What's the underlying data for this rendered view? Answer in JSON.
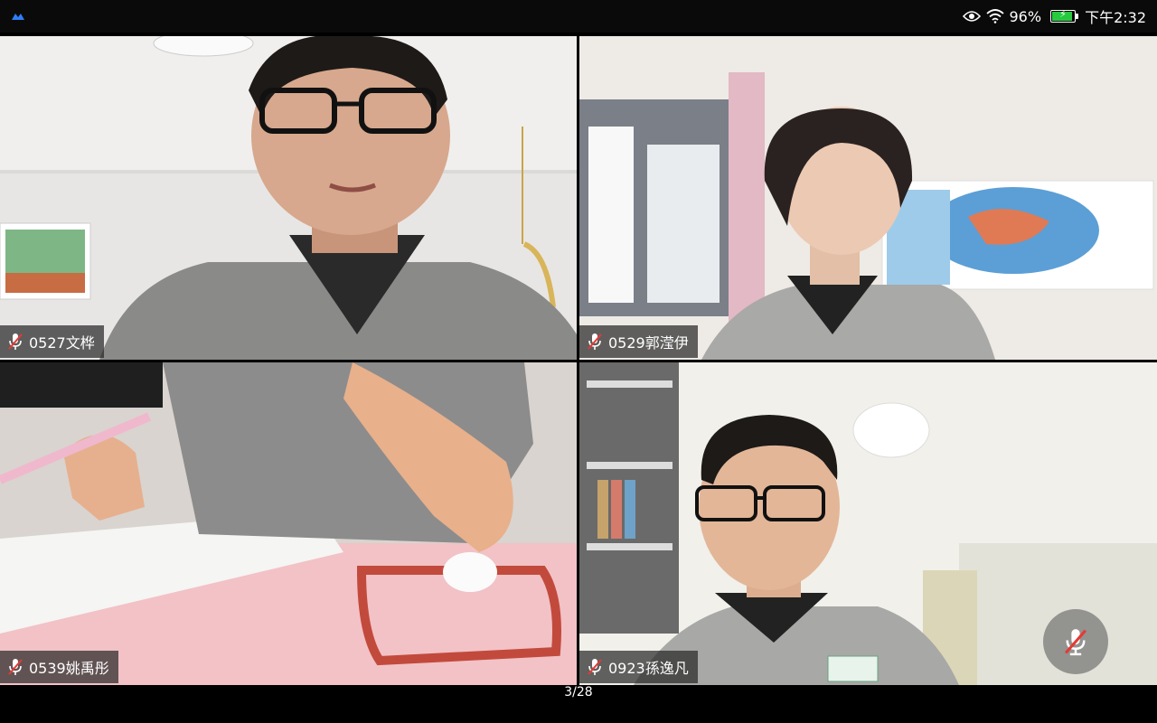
{
  "status_bar": {
    "app_icon": "meeting-app-icon",
    "eye_icon": "eye-comfort-icon",
    "wifi_icon": "wifi-icon",
    "battery_percent": "96%",
    "battery_level": 0.96,
    "battery_color": "#27c93f",
    "time": "下午2:32"
  },
  "participants": [
    {
      "name": "0527文桦",
      "mic_state": "muted",
      "mic_icon": "mic-muted-icon"
    },
    {
      "name": "0529郭滢伊",
      "mic_state": "muted",
      "mic_icon": "mic-muted-icon"
    },
    {
      "name": "0539姚禹彤",
      "mic_state": "muted",
      "mic_icon": "mic-muted-icon"
    },
    {
      "name": "0923孫逸凡",
      "mic_state": "muted",
      "mic_icon": "mic-muted-icon"
    }
  ],
  "page_indicator": "3/28",
  "controls": {
    "mute_button_icon": "mic-muted-icon",
    "accent": "#e53935"
  }
}
